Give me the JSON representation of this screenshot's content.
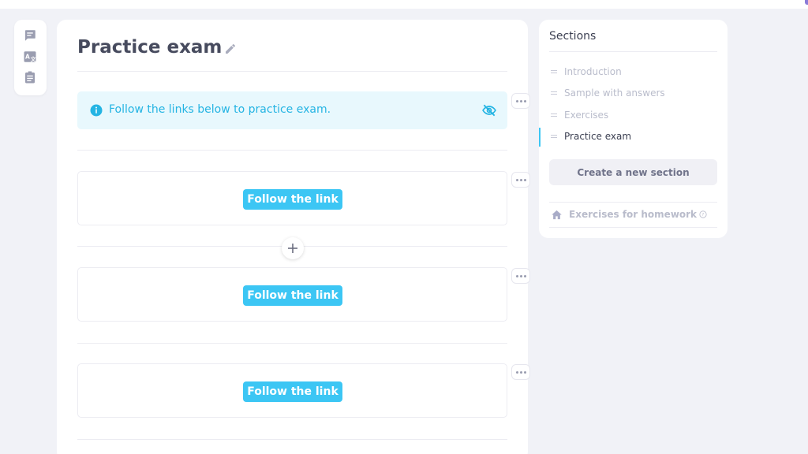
{
  "page": {
    "title": "Practice exam"
  },
  "toolbar": {
    "icons": [
      "comment-icon",
      "translate-icon",
      "clipboard-icon"
    ]
  },
  "info": {
    "text": "Follow the links below to practice  exam."
  },
  "blocks": [
    {
      "button_label": "Follow the link"
    },
    {
      "button_label": "Follow the link"
    },
    {
      "button_label": "Follow the link"
    }
  ],
  "sections": {
    "title": "Sections",
    "items": [
      {
        "label": "Introduction",
        "active": false
      },
      {
        "label": "Sample with answers",
        "active": false
      },
      {
        "label": "Exercises",
        "active": false
      },
      {
        "label": "Practice exam",
        "active": true
      }
    ],
    "create_label": "Create a new section",
    "homework_label": "Exercises for homework"
  },
  "colors": {
    "accent": "#3cc6f4",
    "info_text": "#24b4e3",
    "info_bg": "#e8f8fd",
    "title": "#474b5e"
  }
}
